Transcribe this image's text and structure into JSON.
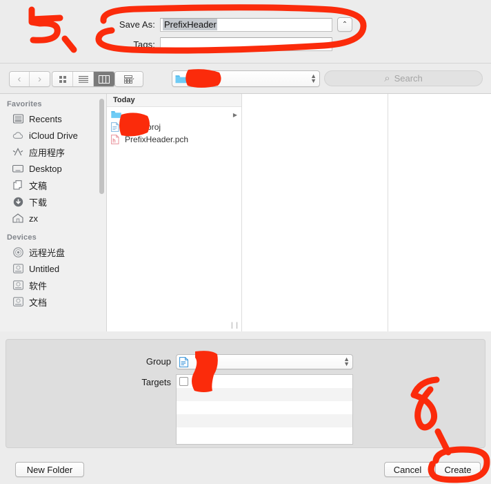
{
  "dialog": {
    "save_as_label": "Save As:",
    "save_as_value": "PrefixHeader",
    "tags_label": "Tags:",
    "tags_value": "",
    "disclosure_glyph": "⌃"
  },
  "toolbar": {
    "back_glyph": "‹",
    "forward_glyph": "›",
    "view_icon": "icon-view",
    "list_icon": "list-view",
    "column_icon": "column-view",
    "arrange_icon": "arrange-by",
    "location_value": "",
    "search_placeholder": "Search",
    "search_glyph": "⌕"
  },
  "sidebar": {
    "sections": [
      {
        "title": "Favorites",
        "items": [
          {
            "label": "Recents",
            "icon": "recents-icon"
          },
          {
            "label": "iCloud Drive",
            "icon": "cloud-icon"
          },
          {
            "label": "应用程序",
            "icon": "applications-icon"
          },
          {
            "label": "Desktop",
            "icon": "desktop-icon"
          },
          {
            "label": "文稿",
            "icon": "documents-icon"
          },
          {
            "label": "下载",
            "icon": "downloads-icon"
          },
          {
            "label": "zx",
            "icon": "home-icon"
          }
        ]
      },
      {
        "title": "Devices",
        "items": [
          {
            "label": "远程光盘",
            "icon": "optical-disc-icon"
          },
          {
            "label": "Untitled",
            "icon": "hard-drive-icon"
          },
          {
            "label": "软件",
            "icon": "hard-drive-icon"
          },
          {
            "label": "文档",
            "icon": "hard-drive-icon"
          }
        ]
      }
    ]
  },
  "browser": {
    "column_header": "Today",
    "files": [
      {
        "name": "",
        "icon": "folder-icon",
        "has_children": true
      },
      {
        "name": "xcodeproj",
        "icon": "document-icon",
        "has_children": false
      },
      {
        "name": "PrefixHeader.pch",
        "icon": "header-file-icon",
        "has_children": false
      }
    ]
  },
  "accessory": {
    "group_label": "Group",
    "group_value": "",
    "targets_label": "Targets",
    "target_rows": [
      {
        "name": "",
        "checked": false,
        "icon": "xcode-target-icon"
      },
      {
        "name": "",
        "checked": null,
        "icon": ""
      },
      {
        "name": "",
        "checked": null,
        "icon": ""
      },
      {
        "name": "",
        "checked": null,
        "icon": ""
      },
      {
        "name": "",
        "checked": null,
        "icon": ""
      }
    ]
  },
  "buttons": {
    "new_folder": "New Folder",
    "cancel": "Cancel",
    "create": "Create"
  },
  "annotations": {
    "step_five": "5、",
    "step_six": "6",
    "color": "#FB2B0B"
  }
}
